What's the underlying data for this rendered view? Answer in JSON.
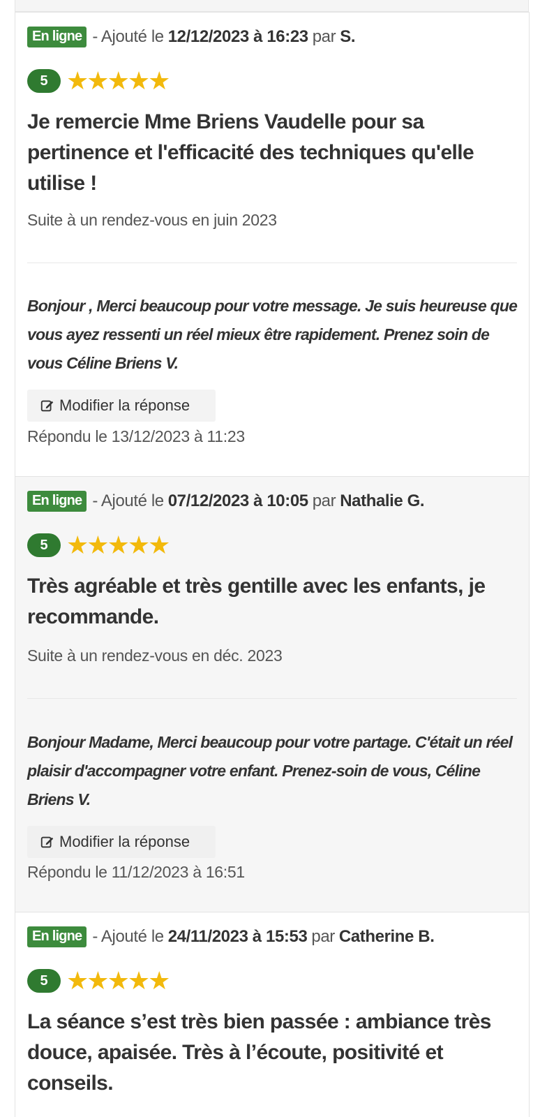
{
  "reviews": [
    {
      "status": "En ligne",
      "added_prefix": "- Ajouté le",
      "date_time": "12/12/2023 à 16:23",
      "by_label": "par",
      "author": "S.",
      "score": "5",
      "stars": 5,
      "title": "Je remercie Mme Briens Vaudelle pour sa pertinence et l'efficacité des techniques qu'elle utilise !",
      "visit": "Suite à un rendez-vous en juin 2023",
      "reply": "Bonjour , Merci beaucoup pour votre message. Je suis heureuse que vous ayez ressenti un réel mieux être rapidement. Prenez soin de vous Céline Briens V.",
      "edit_label": "Modifier la réponse",
      "answered": "Répondu le 13/12/2023 à 11:23"
    },
    {
      "status": "En ligne",
      "added_prefix": "- Ajouté le",
      "date_time": "07/12/2023 à 10:05",
      "by_label": "par",
      "author": "Nathalie G.",
      "score": "5",
      "stars": 5,
      "title": "Très agréable et très gentille avec les enfants, je recommande.",
      "visit": "Suite à un rendez-vous en déc. 2023",
      "reply": "Bonjour Madame, Merci beaucoup pour votre partage. C'était un réel plaisir d'accompagner votre enfant. Prenez-soin de vous, Céline Briens V.",
      "edit_label": "Modifier la réponse",
      "answered": "Répondu le 11/12/2023 à 16:51"
    },
    {
      "status": "En ligne",
      "added_prefix": "- Ajouté le",
      "date_time": "24/11/2023 à 15:53",
      "by_label": "par",
      "author": "Catherine B.",
      "score": "5",
      "stars": 5,
      "title": "La séance s’est très bien passée : ambiance très douce, apaisée. Très à l’écoute, positivité et conseils."
    }
  ],
  "colors": {
    "badge_green": "#3d8b3d",
    "score_green": "#2f7a30",
    "star_gold": "#f2b90c"
  },
  "icons": {
    "edit": "edit-icon",
    "star": "star-icon"
  }
}
